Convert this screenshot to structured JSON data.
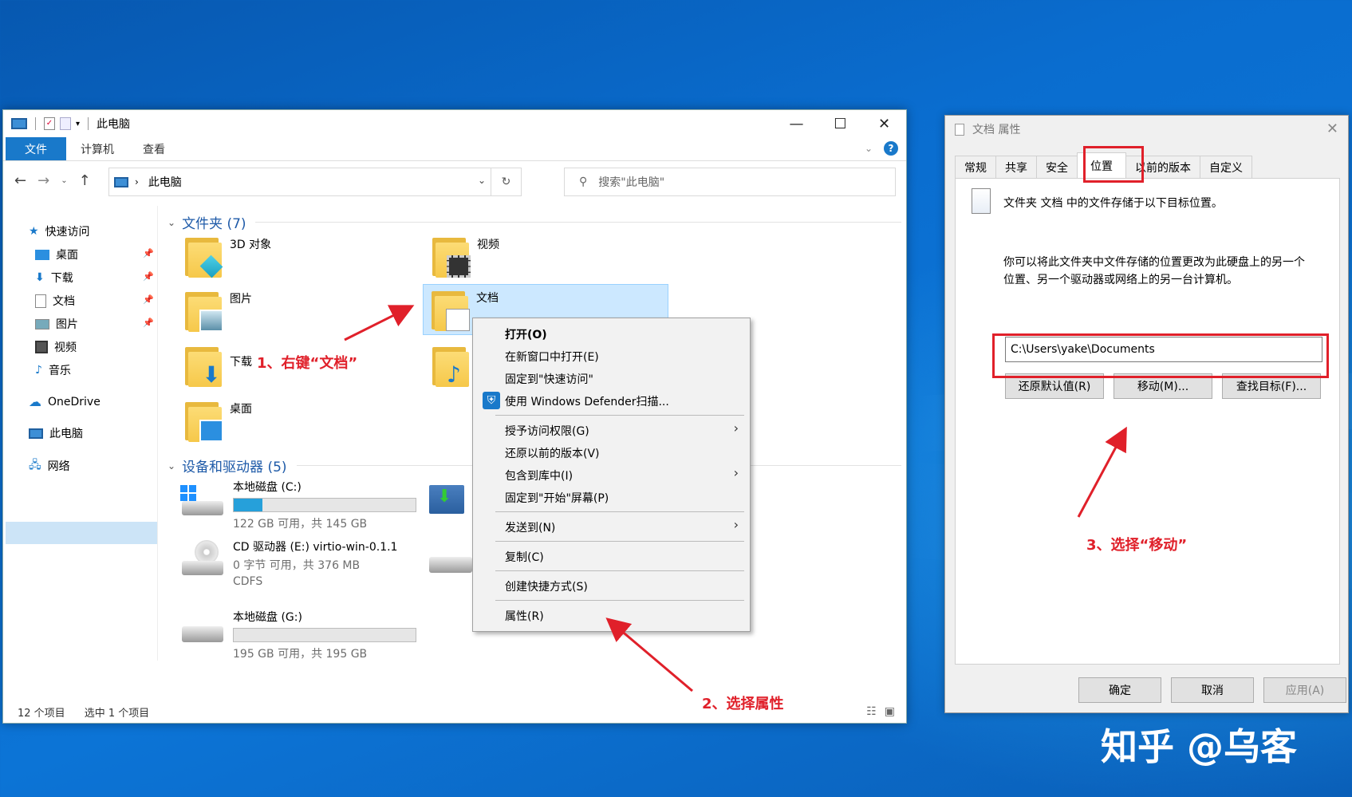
{
  "explorer": {
    "title": "此电脑",
    "ribbon_tabs": [
      "文件",
      "计算机",
      "查看"
    ],
    "address": "此电脑",
    "search_placeholder": "搜索\"此电脑\"",
    "sidebar": [
      {
        "label": "快速访问",
        "icon": "star-icon"
      },
      {
        "label": "桌面",
        "icon": "desktop-icon",
        "pinned": true
      },
      {
        "label": "下载",
        "icon": "download-icon",
        "pinned": true
      },
      {
        "label": "文档",
        "icon": "document-icon",
        "pinned": true
      },
      {
        "label": "图片",
        "icon": "picture-icon",
        "pinned": true
      },
      {
        "label": "视频",
        "icon": "video-icon"
      },
      {
        "label": "音乐",
        "icon": "music-icon"
      },
      {
        "label": "OneDrive",
        "icon": "cloud-icon"
      },
      {
        "label": "此电脑",
        "icon": "computer-icon",
        "selected": true
      },
      {
        "label": "网络",
        "icon": "network-icon"
      }
    ],
    "folders_header": "文件夹 (7)",
    "folders": [
      "3D 对象",
      "视频",
      "图片",
      "文档",
      "下载",
      "桌面"
    ],
    "devices_header": "设备和驱动器 (5)",
    "drives": [
      {
        "name": "本地磁盘 (C:)",
        "info": "122 GB 可用，共 145 GB",
        "used": 0.16
      },
      {
        "name": "CD 驱动器 (E:) virtio-win-0.1.1",
        "info": "0 字节 可用，共 376 MB",
        "fs": "CDFS"
      },
      {
        "name": "本地磁盘 (G:)",
        "info": "195 GB 可用，共 195 GB",
        "used": 0.0
      }
    ],
    "status_items": "12 个项目",
    "status_selected": "选中 1 个项目"
  },
  "context_menu": {
    "items": [
      {
        "label": "打开(O)",
        "bold": true
      },
      {
        "label": "在新窗口中打开(E)"
      },
      {
        "label": "固定到\"快速访问\""
      },
      {
        "label": "使用 Windows Defender扫描..."
      },
      {
        "label": "授予访问权限(G)",
        "submenu": true
      },
      {
        "label": "还原以前的版本(V)"
      },
      {
        "label": "包含到库中(I)",
        "submenu": true
      },
      {
        "label": "固定到\"开始\"屏幕(P)"
      },
      {
        "label": "发送到(N)",
        "submenu": true
      },
      {
        "label": "复制(C)"
      },
      {
        "label": "创建快捷方式(S)"
      },
      {
        "label": "属性(R)"
      }
    ]
  },
  "dialog": {
    "title": "文档 属性",
    "tabs": [
      "常规",
      "共享",
      "安全",
      "位置",
      "以前的版本",
      "自定义"
    ],
    "active_tab": "位置",
    "desc1": "文件夹 文档 中的文件存储于以下目标位置。",
    "desc2a": "你可以将此文件夹中文件存储的位置更改为此硬盘上的另一个",
    "desc2b": "位置、另一个驱动器或网络上的另一台计算机。",
    "path": "C:\\Users\\yake\\Documents",
    "btn_restore": "还原默认值(R)",
    "btn_move": "移动(M)...",
    "btn_find": "查找目标(F)...",
    "btn_ok": "确定",
    "btn_cancel": "取消",
    "btn_apply": "应用(A)"
  },
  "annotations": {
    "step1": "1、右键“文档”",
    "step2": "2、选择属性",
    "step3": "3、选择“移动”",
    "color": "#e0202a"
  },
  "watermark": "知乎 @乌客"
}
